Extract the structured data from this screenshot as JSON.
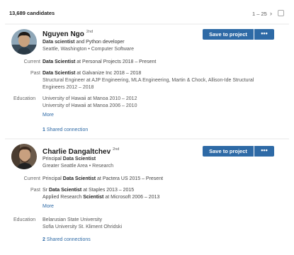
{
  "header": {
    "count": "13,689 candidates",
    "pagination": "1 – 25",
    "next_icon": "chevron-right-icon"
  },
  "candidates": [
    {
      "name": "Nguyen Ngo",
      "degree": "2nd",
      "headline_bold": "Data scientist",
      "headline_rest": " and Python developer",
      "location": "Seattle, Washington • Computer Software",
      "save_label": "Save to project",
      "more_label": "•••",
      "current_label": "Current",
      "current": {
        "title": "Data Scientist",
        "rest": " at Personal Projects  2018 – Present"
      },
      "past_label": "Past",
      "past": [
        {
          "title": "Data Scientist",
          "rest": " at Galvanize Inc  2018 – 2018"
        },
        {
          "line1": "Structural Engineer at AJP Engineering, MLA Engineering, Martin & Chock, Allison-Ide Structural",
          "line2": "Engineers  2012 – 2018"
        }
      ],
      "education_label": "Education",
      "education": [
        "University of Hawaii at Manoa  2010 – 2012",
        "University of Hawaii at Manoa  2006 – 2010"
      ],
      "more_link": "More",
      "connections_count": "1",
      "connections_text": " Shared connection"
    },
    {
      "name": "Charlie Dangaltchev",
      "degree": "2nd",
      "headline_pre": "Principal ",
      "headline_bold": "Data Scientist",
      "location": "Greater Seattle Area • Research",
      "save_label": "Save to project",
      "more_label": "•••",
      "current_label": "Current",
      "current": {
        "pre": "Principal ",
        "title": "Data Scientist",
        "rest": " at Pactera US  2015 – Present"
      },
      "past_label": "Past",
      "past": [
        {
          "pre": "Sr ",
          "title": "Data Scientist",
          "rest": " at Staples  2013 – 2015"
        },
        {
          "pre": "Applied Research ",
          "title": "Scientist",
          "rest": " at Microsoft  2006 – 2013"
        }
      ],
      "more_link": "More",
      "education_label": "Education",
      "education": [
        "Belarusian State University",
        "Sofia University St. Kliment Ohridski"
      ],
      "connections_count": "2",
      "connections_text": " Shared connections"
    }
  ]
}
